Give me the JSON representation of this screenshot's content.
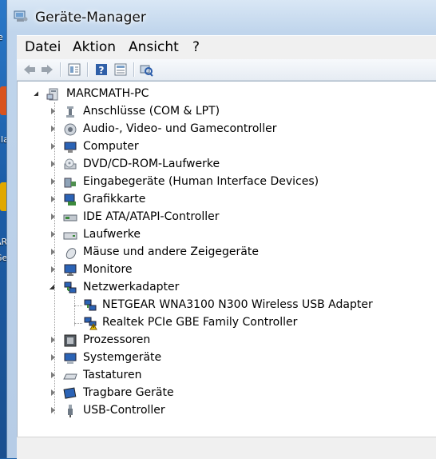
{
  "window": {
    "title": "Geräte-Manager"
  },
  "menu": [
    "Datei",
    "Aktion",
    "Ansicht",
    "?"
  ],
  "toolbar": {
    "buttons": [
      "back-arrow-icon",
      "forward-arrow-icon",
      "properties-icon",
      "help-icon",
      "view-icon",
      "scan-hardware-icon"
    ]
  },
  "desktop": {
    "fragments": [
      "ie",
      "lla",
      "AR",
      "Ge"
    ]
  },
  "tree": {
    "root": "MARCMATH-PC",
    "categories": [
      "Anschlüsse (COM & LPT)",
      "Audio-, Video- und Gamecontroller",
      "Computer",
      "DVD/CD-ROM-Laufwerke",
      "Eingabegeräte (Human Interface Devices)",
      "Grafikkarte",
      "IDE ATA/ATAPI-Controller",
      "Laufwerke",
      "Mäuse und andere Zeigegeräte",
      "Monitore",
      "Netzwerkadapter",
      "Prozessoren",
      "Systemgeräte",
      "Tastaturen",
      "Tragbare Geräte",
      "USB-Controller"
    ],
    "network_children": [
      "NETGEAR WNA3100 N300 Wireless USB Adapter",
      "Realtek PCIe GBE Family Controller"
    ]
  }
}
